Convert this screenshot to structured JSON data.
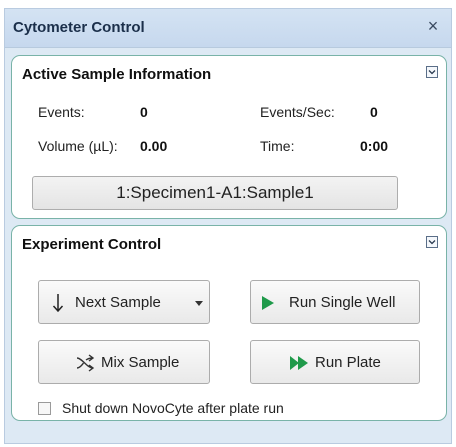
{
  "panel": {
    "title": "Cytometer Control",
    "close_glyph": "×"
  },
  "active_sample": {
    "title": "Active Sample Information",
    "events_label": "Events:",
    "events_value": "0",
    "events_sec_label": "Events/Sec:",
    "events_sec_value": "0",
    "volume_label": "Volume (µL):",
    "volume_value": "0.00",
    "time_label": "Time:",
    "time_value": "0:00",
    "sample_button": "1:Specimen1-A1:Sample1"
  },
  "experiment": {
    "title": "Experiment Control",
    "next_sample": "Next Sample",
    "run_single_well": "Run Single Well",
    "mix_sample": "Mix Sample",
    "run_plate": "Run Plate",
    "shutdown_label": "Shut down NovoCyte after plate run",
    "shutdown_checked": false
  },
  "icons": {
    "collapse": "chevron-down-box-icon",
    "next": "down-arrow-icon",
    "dropdown": "dropdown-caret-icon",
    "mix": "mix-arrows-icon",
    "run_single": "play-icon",
    "run_plate": "fast-forward-icon"
  },
  "colors": {
    "panel_bg": "#dde9f4",
    "group_border": "#79b3a8",
    "play_green": "#1f9a4a"
  }
}
